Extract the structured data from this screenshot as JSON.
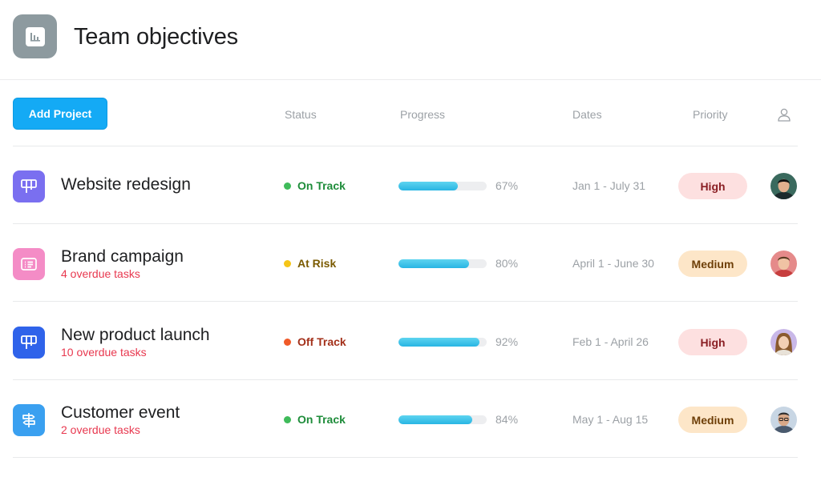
{
  "header": {
    "title": "Team objectives",
    "icon": "bar-chart-icon",
    "icon_color": "#8d9a9f"
  },
  "toolbar": {
    "add_project_label": "Add Project",
    "accent": "#14aaf5"
  },
  "columns": {
    "status": "Status",
    "progress": "Progress",
    "dates": "Dates",
    "priority": "Priority",
    "owner_icon": "person-icon"
  },
  "projects": [
    {
      "name": "Website redesign",
      "overdue": "",
      "icon": "board-icon",
      "icon_color": "#7a6ff0",
      "status": "On Track",
      "status_color": "#1e8c3a",
      "status_dot": "#3fbb5a",
      "progress": 67,
      "progress_label": "67%",
      "dates": "Jan 1 - July 31",
      "priority": "High",
      "priority_bg": "#fde0e0",
      "priority_color": "#8a1f24",
      "avatar": "avatar-dark-hair-man"
    },
    {
      "name": "Brand campaign",
      "overdue": "4 overdue tasks",
      "icon": "list-card-icon",
      "icon_color": "#f48cc6",
      "status": "At Risk",
      "status_color": "#7a5a00",
      "status_dot": "#f5c518",
      "progress": 80,
      "progress_label": "80%",
      "dates": "April 1 - June 30",
      "priority": "Medium",
      "priority_bg": "#fde6c8",
      "priority_color": "#6e3f08",
      "avatar": "avatar-red-shirt-man"
    },
    {
      "name": "New product launch",
      "overdue": "10 overdue tasks",
      "icon": "board-icon",
      "icon_color": "#2f63ea",
      "status": "Off Track",
      "status_color": "#a3301a",
      "status_dot": "#f05a28",
      "progress": 92,
      "progress_label": "92%",
      "dates": "Feb 1 - April 26",
      "priority": "High",
      "priority_bg": "#fde0e0",
      "priority_color": "#8a1f24",
      "avatar": "avatar-long-hair-woman"
    },
    {
      "name": "Customer event",
      "overdue": "2 overdue tasks",
      "icon": "signpost-icon",
      "icon_color": "#3aa0f0",
      "status": "On Track",
      "status_color": "#1e8c3a",
      "status_dot": "#3fbb5a",
      "progress": 84,
      "progress_label": "84%",
      "dates": "May 1 - Aug 15",
      "priority": "Medium",
      "priority_bg": "#fde6c8",
      "priority_color": "#6e3f08",
      "avatar": "avatar-glasses-man"
    }
  ]
}
